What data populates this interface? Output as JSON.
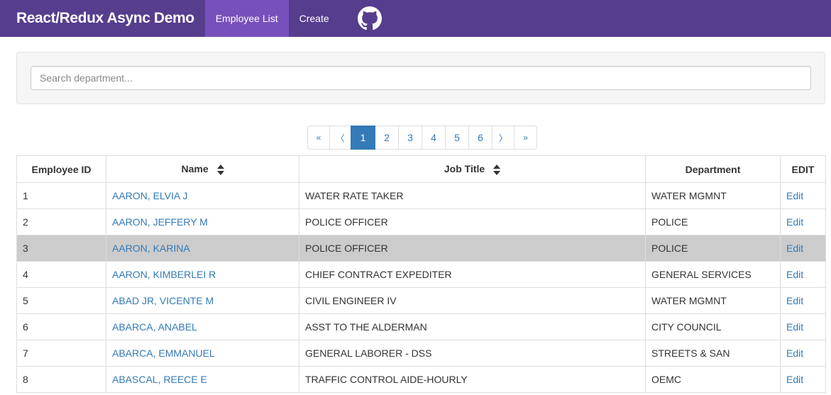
{
  "nav": {
    "brand": "React/Redux Async Demo",
    "items": [
      {
        "label": "Employee List",
        "active": true
      },
      {
        "label": "Create",
        "active": false
      }
    ],
    "github_icon": "github-icon"
  },
  "search": {
    "placeholder": "Search department...",
    "value": ""
  },
  "pagination": {
    "first": "«",
    "prev": "〈",
    "next": "〉",
    "last": "»",
    "pages": [
      "1",
      "2",
      "3",
      "4",
      "5",
      "6"
    ],
    "active_page": "1"
  },
  "table": {
    "headers": {
      "id": "Employee ID",
      "name": "Name",
      "job": "Job Title",
      "department": "Department",
      "edit": "EDIT"
    },
    "edit_label": "Edit",
    "highlighted_row": 2,
    "rows": [
      {
        "id": "1",
        "name": "AARON, ELVIA J",
        "job": "WATER RATE TAKER",
        "department": "WATER MGMNT"
      },
      {
        "id": "2",
        "name": "AARON, JEFFERY M",
        "job": "POLICE OFFICER",
        "department": "POLICE"
      },
      {
        "id": "3",
        "name": "AARON, KARINA",
        "job": "POLICE OFFICER",
        "department": "POLICE"
      },
      {
        "id": "4",
        "name": "AARON, KIMBERLEI R",
        "job": "CHIEF CONTRACT EXPEDITER",
        "department": "GENERAL SERVICES"
      },
      {
        "id": "5",
        "name": "ABAD JR, VICENTE M",
        "job": "CIVIL ENGINEER IV",
        "department": "WATER MGMNT"
      },
      {
        "id": "6",
        "name": "ABARCA, ANABEL",
        "job": "ASST TO THE ALDERMAN",
        "department": "CITY COUNCIL"
      },
      {
        "id": "7",
        "name": "ABARCA, EMMANUEL",
        "job": "GENERAL LABORER - DSS",
        "department": "STREETS & SAN"
      },
      {
        "id": "8",
        "name": "ABASCAL, REECE E",
        "job": "TRAFFIC CONTROL AIDE-HOURLY",
        "department": "OEMC"
      }
    ]
  },
  "colors": {
    "navbar": "#563d8e",
    "nav_active": "#7850bd",
    "link": "#337ab7",
    "highlight_row": "#cccccc"
  }
}
